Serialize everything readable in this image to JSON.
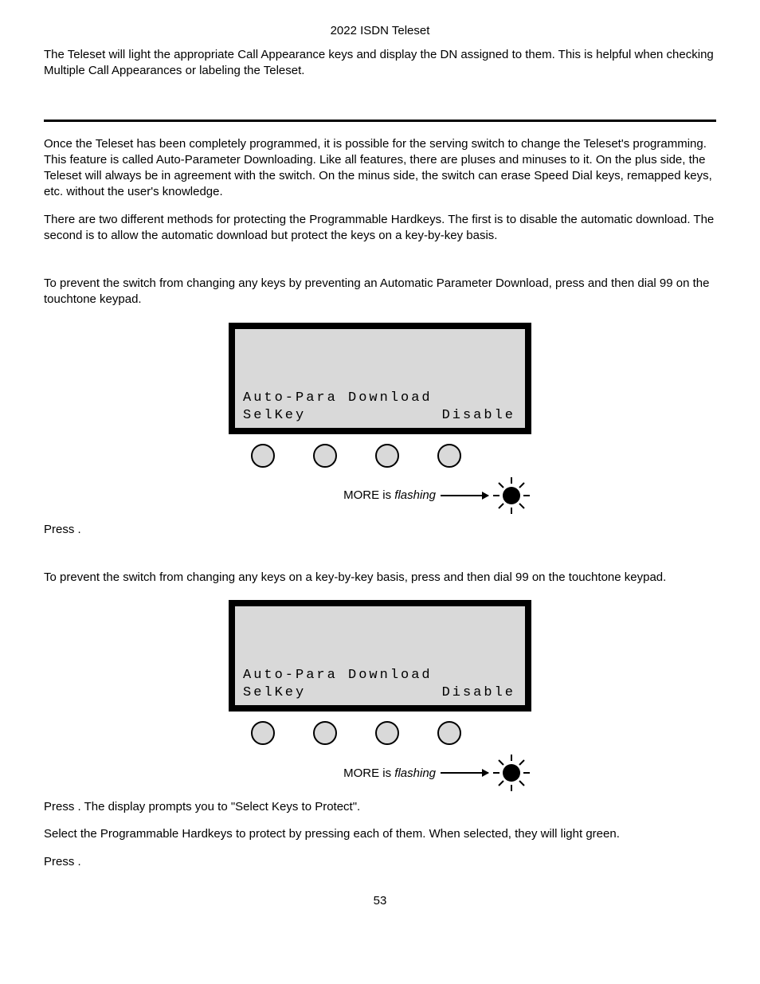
{
  "header": {
    "title": "2022 ISDN Teleset"
  },
  "intro": {
    "p1": "The Teleset will light the appropriate Call Appearance keys and display the DN assigned to them. This is helpful when checking Multiple Call Appearances or labeling the Teleset."
  },
  "section": {
    "p1": "Once the Teleset has been completely programmed, it is possible for the serving switch to change the Teleset's programming. This feature is called Auto-Parameter Downloading. Like all features, there are pluses and minuses to it. On the plus side, the Teleset will always be in agreement with the switch. On the minus side, the switch can erase Speed Dial keys, remapped keys, etc. without the user's knowledge.",
    "p2": "There are two different methods for protecting the Programmable Hardkeys. The first is to disable the automatic download. The second is to allow the automatic download but protect the keys on a key-by-key basis."
  },
  "disable": {
    "instr_a": "To prevent the switch from changing any keys by preventing an Automatic Parameter Download, press ",
    "instr_b": " and then dial 99 on the touchtone keypad.",
    "press_a": "Press ",
    "press_b": "."
  },
  "selkey": {
    "instr_a": "To prevent the switch from changing any keys on a key-by-key basis, press ",
    "instr_b": " and then dial 99 on the touchtone keypad.",
    "press2_a": "Press ",
    "press2_b": ". The display prompts you to \"Select Keys to Protect\".",
    "p_select": "Select the Programmable Hardkeys to protect by pressing each of them. When selected, they will light green.",
    "press3_a": "Press ",
    "press3_b": "."
  },
  "lcd": {
    "line1": "Auto-Para Download",
    "line2_left": "SelKey",
    "line2_right": "Disable"
  },
  "more": {
    "label_a": "MORE is ",
    "label_b": "flashing"
  },
  "page": "53"
}
